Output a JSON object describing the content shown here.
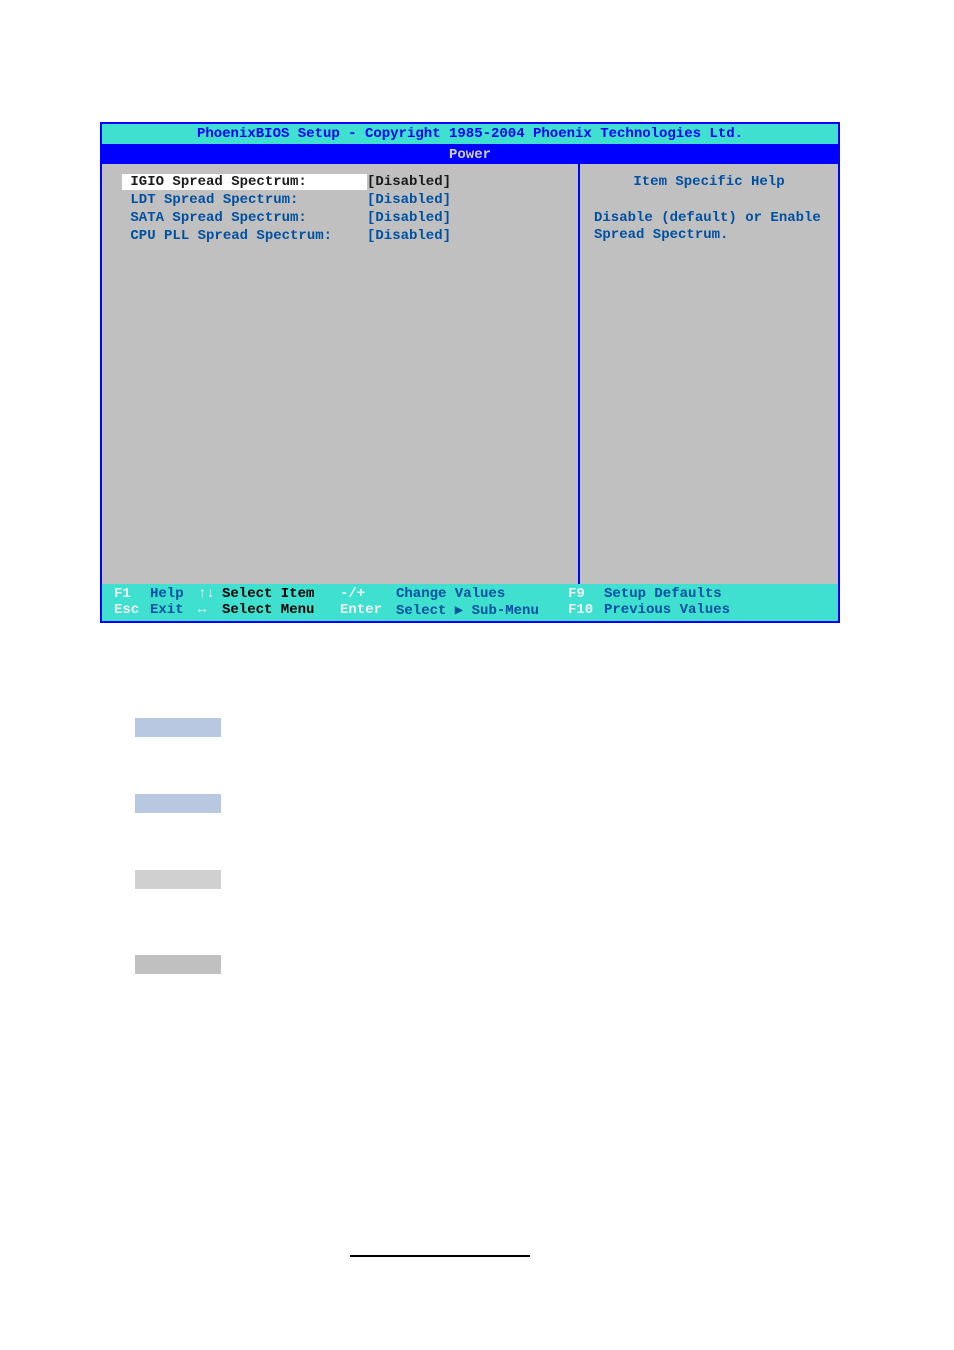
{
  "bios": {
    "title": "PhoenixBIOS Setup - Copyright 1985-2004 Phoenix Technologies Ltd.",
    "menuTab": "Power",
    "items": [
      {
        "label": "IGIO Spread Spectrum:",
        "value": "[Disabled]",
        "selected": true
      },
      {
        "label": "LDT Spread Spectrum:",
        "value": "[Disabled]",
        "selected": false
      },
      {
        "label": "SATA Spread Spectrum:",
        "value": "[Disabled]",
        "selected": false
      },
      {
        "label": "CPU PLL Spread Spectrum:",
        "value": "[Disabled]",
        "selected": false
      }
    ],
    "help": {
      "title": "Item Specific Help",
      "text": "Disable (default) or Enable Spread Spectrum."
    },
    "footer": {
      "row1": {
        "k1": "F1",
        "a1": "Help",
        "k2": "↑↓",
        "a2": "Select Item",
        "k3": "-/+",
        "a3": "Change Values",
        "k4": "F9",
        "a4": "Setup Defaults"
      },
      "row2": {
        "k1": "Esc",
        "a1": "Exit",
        "k2": "↔",
        "a2": "Select Menu",
        "k3": "Enter",
        "a3": "Select ▶ Sub-Menu",
        "k4": "F10",
        "a4": "Previous Values"
      }
    }
  }
}
